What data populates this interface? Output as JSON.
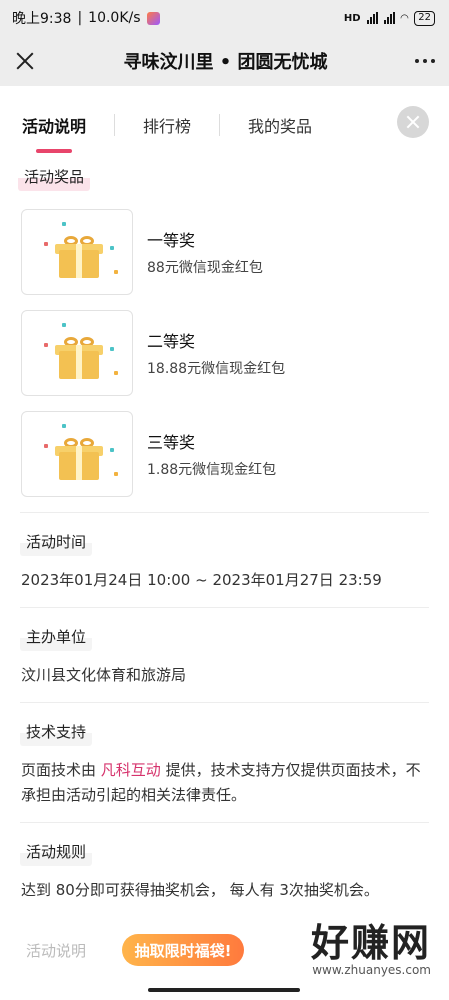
{
  "status_bar": {
    "time": "晚上9:38",
    "speed": "10.0K/s",
    "network_labels": "HD",
    "battery": "22"
  },
  "titlebar": {
    "title": "寻味汶川里 • 团圆无忧城"
  },
  "tabs": [
    {
      "label": "活动说明",
      "active": true
    },
    {
      "label": "排行榜",
      "active": false
    },
    {
      "label": "我的奖品",
      "active": false
    }
  ],
  "prizes_section": {
    "label": "活动奖品",
    "items": [
      {
        "name": "一等奖",
        "desc": "88元微信现金红包"
      },
      {
        "name": "二等奖",
        "desc": "18.88元微信现金红包"
      },
      {
        "name": "三等奖",
        "desc": "1.88元微信现金红包"
      }
    ]
  },
  "time_section": {
    "label": "活动时间",
    "value": "2023年01月24日 10:00 ~ 2023年01月27日 23:59"
  },
  "organizer_section": {
    "label": "主办单位",
    "value": "汶川县文化体育和旅游局"
  },
  "tech_section": {
    "label": "技术支持",
    "prefix": "页面技术由 ",
    "company": "凡科互动",
    "suffix": " 提供，技术支持方仅提供页面技术，不承担由活动引起的相关法律责任。"
  },
  "rules_section": {
    "label": "活动规则",
    "value": "达到 80分即可获得抽奖机会， 每人有 3次抽奖机会。"
  },
  "bottom": {
    "faint_label": "活动说明",
    "lucky_button": "抽取限时福袋!"
  },
  "watermark": {
    "big": "好赚网",
    "small": "www.zhuanyes.com"
  },
  "colors": {
    "accent": "#e8456b",
    "pink_text": "#d6336c",
    "header_bg": "#ededed"
  }
}
